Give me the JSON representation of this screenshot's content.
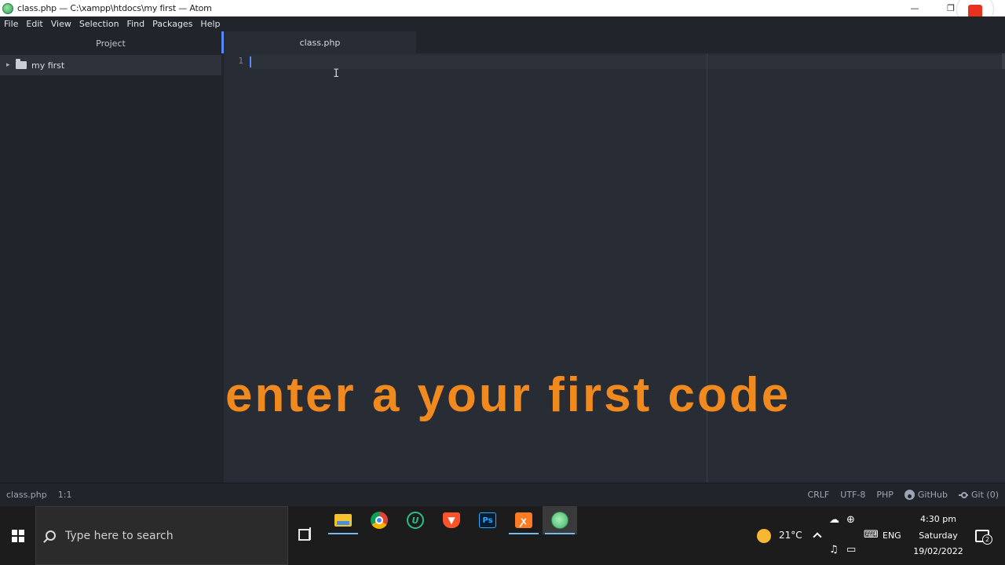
{
  "window": {
    "title": "class.php — C:\\xampp\\htdocs\\my first — Atom",
    "minimize_glyph": "—",
    "restore_glyph": "❐"
  },
  "menu": [
    "File",
    "Edit",
    "View",
    "Selection",
    "Find",
    "Packages",
    "Help"
  ],
  "tree": {
    "header": "Project",
    "items": [
      {
        "label": "my first",
        "expanded": false
      }
    ]
  },
  "tabs": [
    {
      "label": "class.php",
      "active": true
    }
  ],
  "editor": {
    "line_numbers": [
      "1"
    ],
    "caption": "enter a your first code",
    "caption_color": "#f08a1f"
  },
  "status": {
    "file": "class.php",
    "cursor": "1:1",
    "line_ending": "CRLF",
    "encoding": "UTF-8",
    "grammar": "PHP",
    "github": "GitHub",
    "git": "Git (0)"
  },
  "taskbar": {
    "search_placeholder": "Type here to search",
    "apps": [
      {
        "name": "file-explorer",
        "glyph": "",
        "running": true
      },
      {
        "name": "chrome",
        "glyph": "",
        "running": false
      },
      {
        "name": "uc-browser",
        "glyph": "U",
        "running": false
      },
      {
        "name": "brave",
        "glyph": "▼",
        "running": false
      },
      {
        "name": "photoshop",
        "glyph": "Ps",
        "running": false
      },
      {
        "name": "xampp",
        "glyph": "ꭗ",
        "running": true
      },
      {
        "name": "atom",
        "glyph": "",
        "running": true,
        "active": true
      }
    ],
    "weather": "21°C",
    "language": "ENG",
    "time": "4:30 pm",
    "day": "Saturday",
    "date": "19/02/2022",
    "notification_count": "2"
  },
  "colors": {
    "accent": "#568af2",
    "taskbar_underline": "#76b9ed",
    "record": "#e8321f"
  }
}
